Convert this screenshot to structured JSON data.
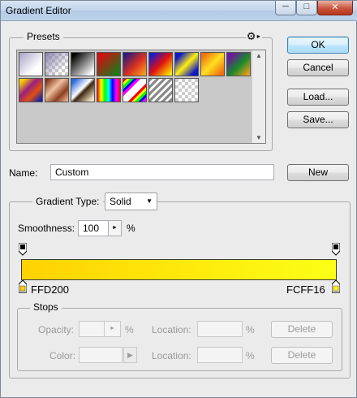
{
  "window": {
    "title": "Gradient Editor"
  },
  "presets": {
    "label": "Presets",
    "menu_icon": "gear-icon",
    "row1": [
      {
        "name": "foreground-to-background",
        "css": "linear-gradient(135deg,#a7a2c6 0%,#ffffff 70%)"
      },
      {
        "name": "foreground-to-transparent",
        "css": "linear-gradient(135deg,#8b86ad 0%,rgba(160,160,190,0) 75%), repeating-conic-gradient(#ffffff 0 25%,#cccccc 0 50%) 0 0/8px 8px"
      },
      {
        "name": "black-white",
        "css": "linear-gradient(135deg,#000000 10%,#ffffff 90%)"
      },
      {
        "name": "red-green",
        "css": "linear-gradient(135deg,#d01010 15%,#1a7a1a 90%)"
      },
      {
        "name": "violet-orange",
        "css": "linear-gradient(135deg,#2d1a7a 10%,#d83020 55%,#f7a020 95%)"
      },
      {
        "name": "blue-red-yellow",
        "css": "linear-gradient(135deg,#1b1bcc 10%,#e01010 50%,#ffee00 95%)"
      },
      {
        "name": "blue-yellow-blue",
        "css": "linear-gradient(135deg,#1018c8 15%,#ffee10 50%,#1018c8 85%)"
      },
      {
        "name": "orange-yellow-orange",
        "css": "linear-gradient(135deg,#f07010 10%,#ffe020 50%,#f07010 90%)"
      },
      {
        "name": "violet-green-orange",
        "css": "linear-gradient(135deg,#6a1a9a 15%,#1a8a2a 55%,#f0a020 95%)"
      }
    ],
    "row2": [
      {
        "name": "yellow-violet-orange-blue",
        "css": "linear-gradient(135deg,#ffd000 10%,#9a2080 40%,#e05010 65%,#1020b0 95%)"
      },
      {
        "name": "copper",
        "css": "linear-gradient(135deg,#7a3010 5%,#f0c0a0 40%,#8a4020 70%,#e8b090 95%)"
      },
      {
        "name": "chrome",
        "css": "linear-gradient(135deg,#2a6ad8 10%,#ffffff 45%,#3a2410 55%,#f0e0c0 90%)"
      },
      {
        "name": "spectrum",
        "css": "linear-gradient(90deg,#ff0000,#ffff00,#00ff00,#00ffff,#0000ff,#ff00ff,#ff0000)"
      },
      {
        "name": "transparent-rainbow",
        "css": "repeating-linear-gradient(135deg,#ff0000 0 3px,#ffff00 3px 6px,#00ff00 6px 9px,#0000ff 9px 12px,#ff00ff 12px 15px,#ffffff 15px 24px)"
      },
      {
        "name": "transparent-stripes",
        "css": "repeating-linear-gradient(135deg,#8a8a8a 0 3px,rgba(255,255,255,0.9) 3px 6px)"
      },
      {
        "name": "transparent",
        "css": "repeating-conic-gradient(#ffffff 0 25%,#cccccc 0 50%) 0 0/8px 8px"
      }
    ]
  },
  "buttons": {
    "ok": "OK",
    "cancel": "Cancel",
    "load": "Load...",
    "save": "Save...",
    "new": "New"
  },
  "name_field": {
    "label": "Name:",
    "value": "Custom"
  },
  "gradient_type": {
    "label": "Gradient Type:",
    "value": "Solid"
  },
  "smoothness": {
    "label": "Smoothness:",
    "value": "100",
    "unit": "%"
  },
  "gradient": {
    "color_stops": [
      {
        "hex": "FFD200",
        "color": "#FFD200",
        "location": 0
      },
      {
        "hex": "FCFF16",
        "color": "#FCFF16",
        "location": 100
      }
    ],
    "opacity_stops": [
      {
        "color": "#000000",
        "location": 0
      },
      {
        "color": "#000000",
        "location": 100
      }
    ]
  },
  "stops": {
    "label": "Stops",
    "opacity_label": "Opacity:",
    "opacity_unit": "%",
    "color_label": "Color:",
    "location_label": "Location:",
    "location_unit": "%",
    "delete_label": "Delete"
  },
  "colors": {
    "accent": "#3c7fb1"
  }
}
